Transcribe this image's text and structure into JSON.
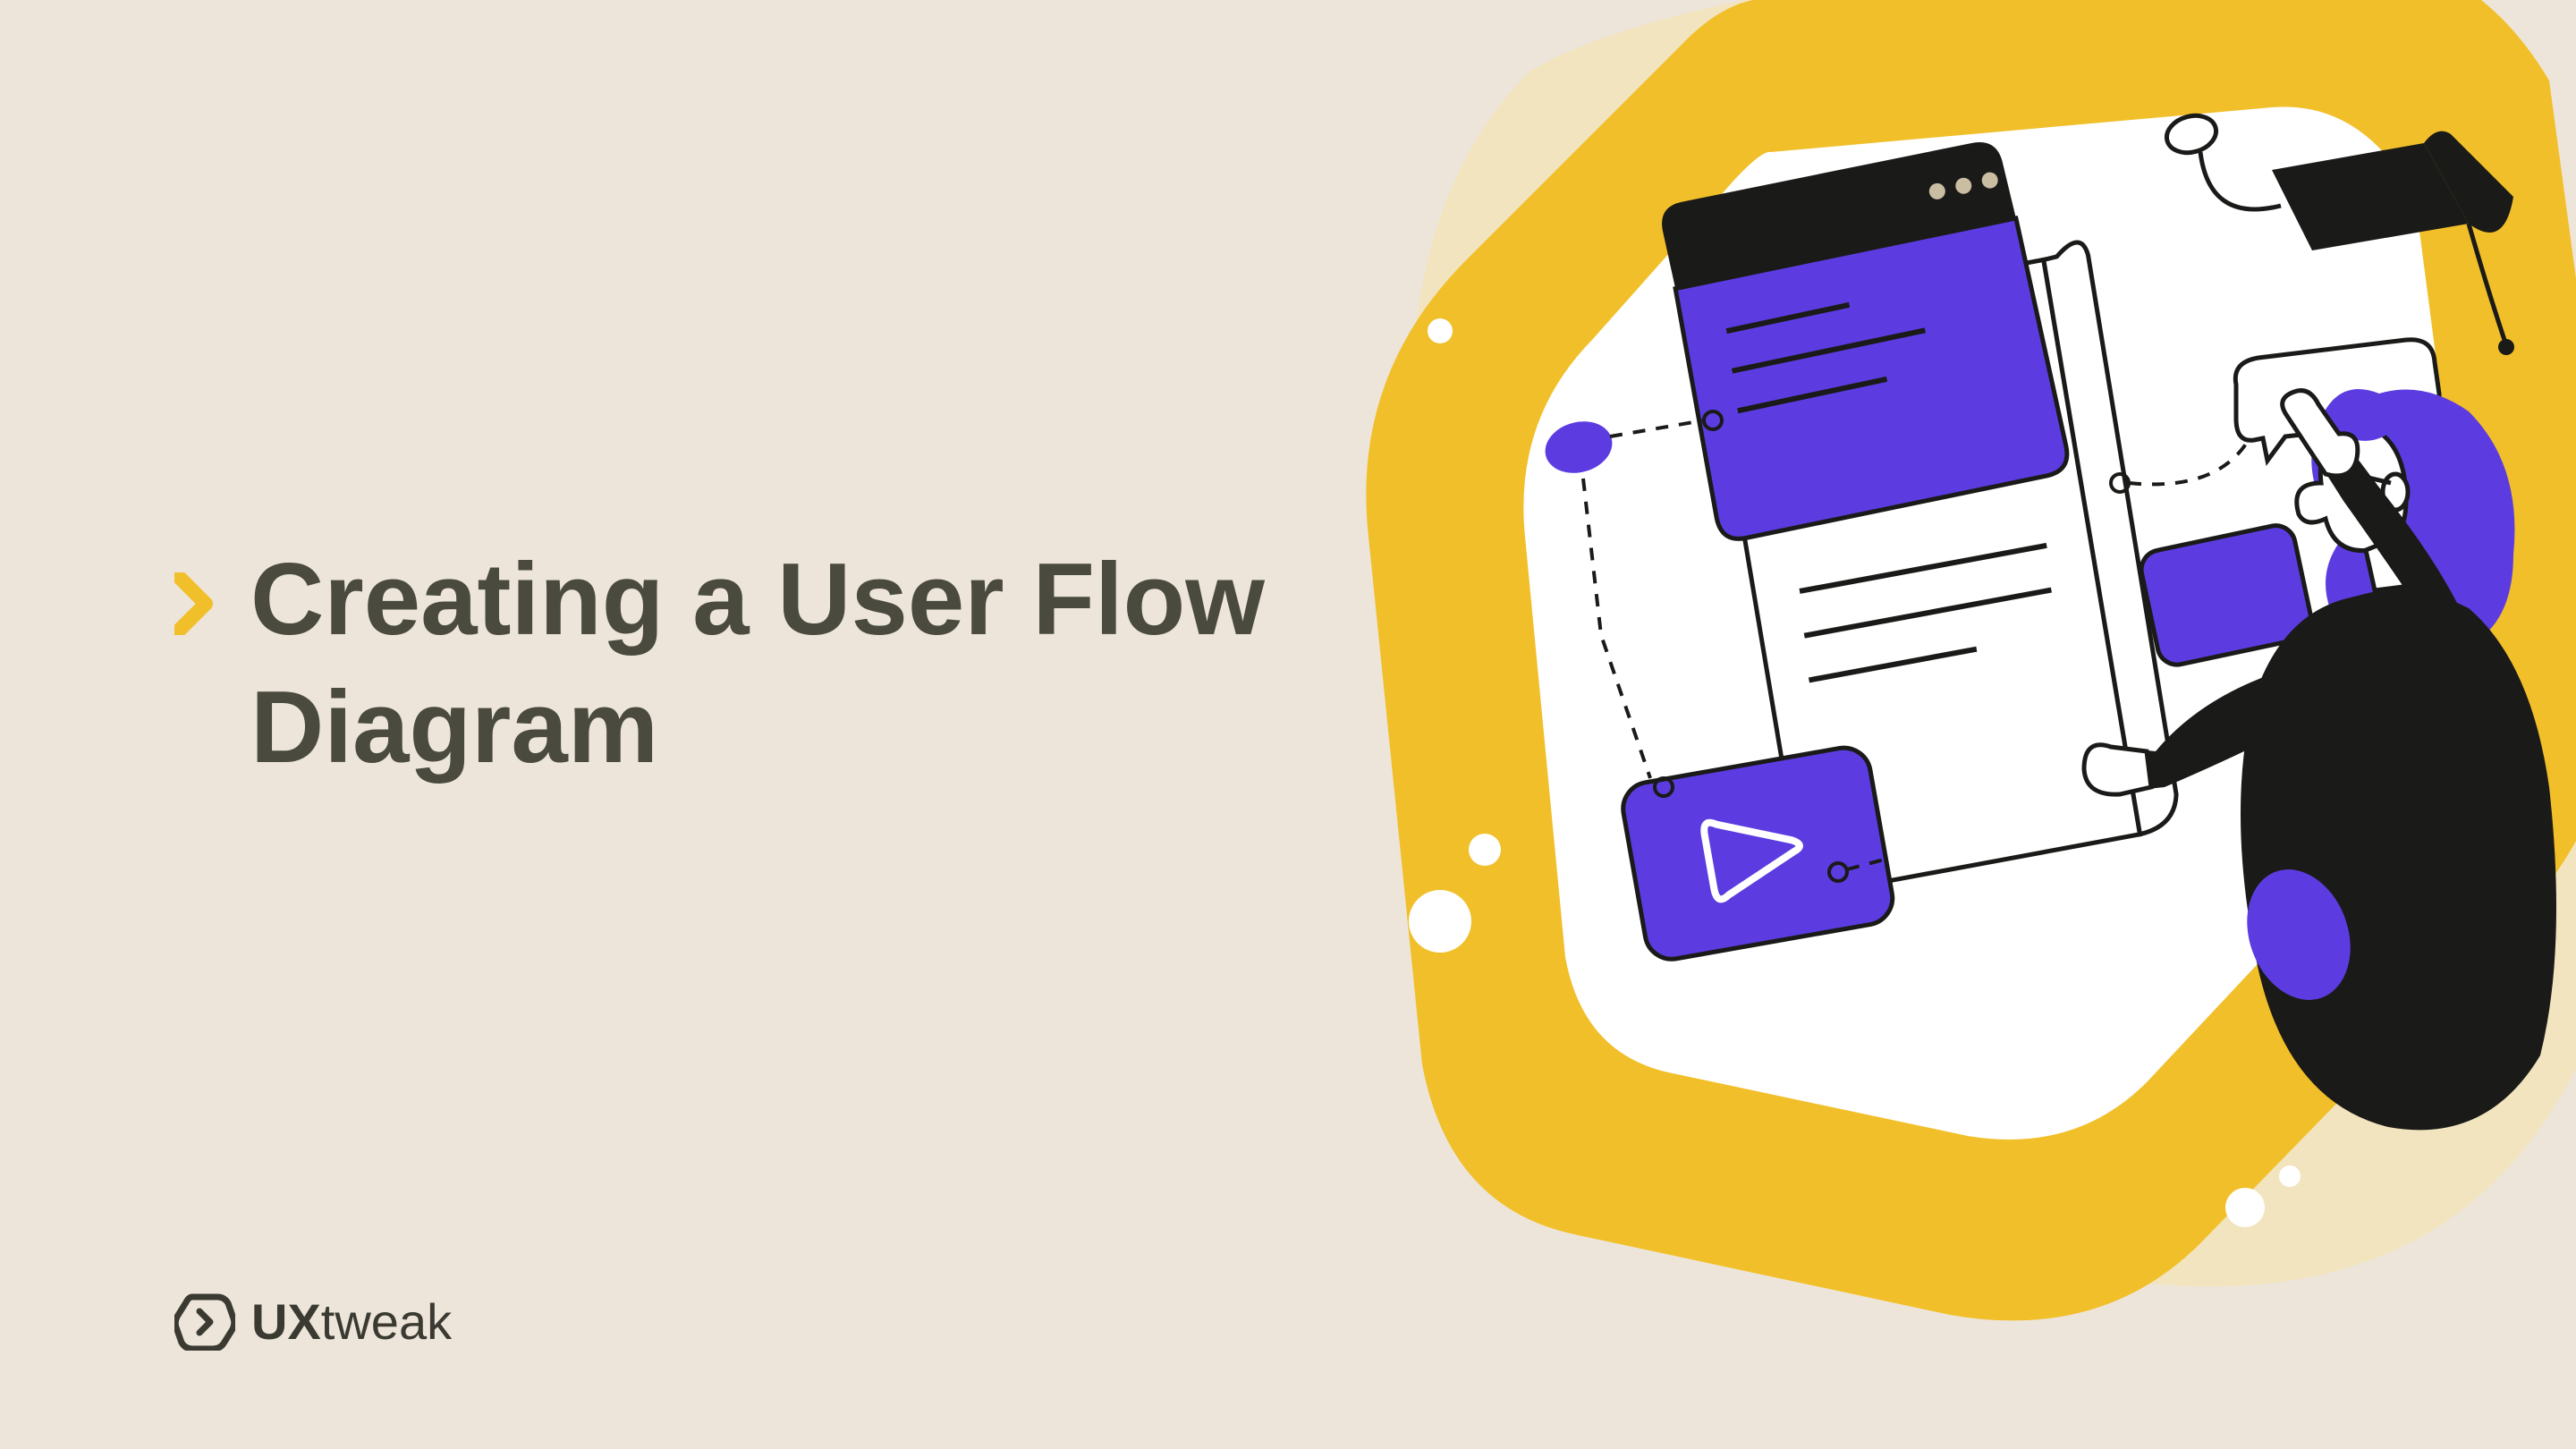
{
  "title": "Creating a User Flow Diagram",
  "logo": {
    "bold": "UX",
    "light": "tweak"
  },
  "colors": {
    "background": "#ede5d9",
    "text": "#4a4a3f",
    "accent_yellow": "#f1bf29",
    "accent_purple": "#5c3ce0",
    "dark": "#1a1a18"
  }
}
